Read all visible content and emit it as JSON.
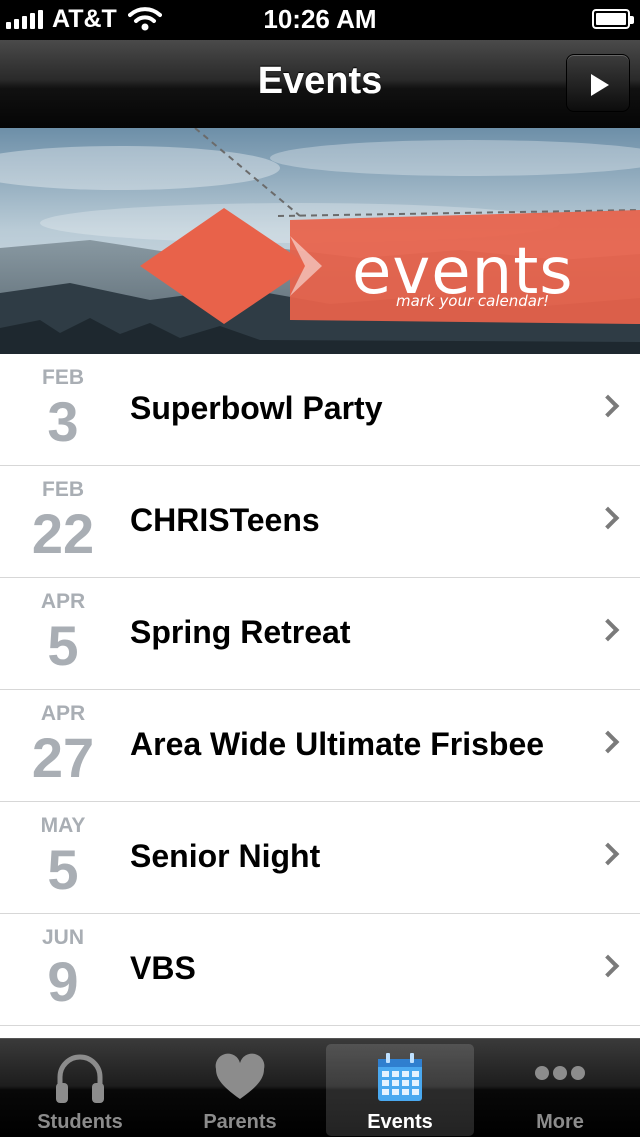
{
  "status_bar": {
    "carrier": "AT&T",
    "time": "10:26 AM",
    "battery_level": 1.0
  },
  "nav_bar": {
    "title": "Events",
    "right_button_icon": "play-icon"
  },
  "banner": {
    "word": "events",
    "tagline": "mark your calendar!",
    "accent_color": "#e8624a"
  },
  "events": [
    {
      "month": "FEB",
      "day": "3",
      "title": "Superbowl Party"
    },
    {
      "month": "FEB",
      "day": "22",
      "title": "CHRISTeens"
    },
    {
      "month": "APR",
      "day": "5",
      "title": "Spring Retreat"
    },
    {
      "month": "APR",
      "day": "27",
      "title": "Area Wide Ultimate Frisbee"
    },
    {
      "month": "MAY",
      "day": "5",
      "title": "Senior Night"
    },
    {
      "month": "JUN",
      "day": "9",
      "title": "VBS"
    }
  ],
  "tab_bar": {
    "tabs": [
      {
        "label": "Students",
        "icon": "headphones-icon",
        "active": false
      },
      {
        "label": "Parents",
        "icon": "heart-icon",
        "active": false
      },
      {
        "label": "Events",
        "icon": "calendar-icon",
        "active": true
      },
      {
        "label": "More",
        "icon": "more-dots-icon",
        "active": false
      }
    ]
  }
}
